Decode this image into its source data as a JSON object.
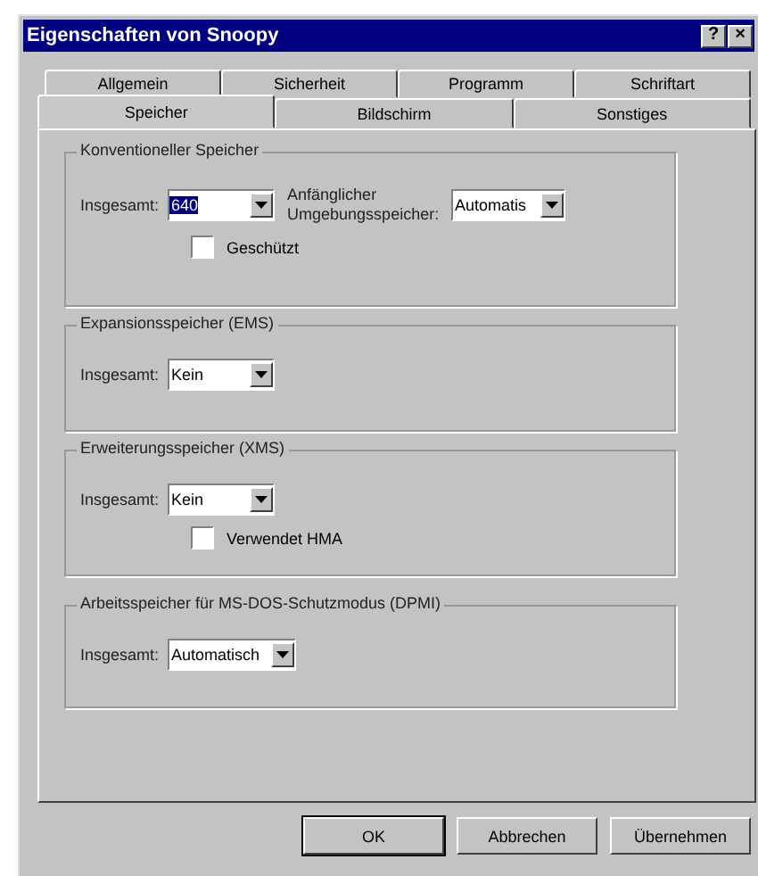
{
  "window": {
    "title": "Eigenschaften von Snoopy",
    "title_buttons": [
      "?",
      "×"
    ]
  },
  "tab_rows": [
    [
      {
        "label": "Allgemein",
        "selected": false
      },
      {
        "label": "Sicherheit",
        "selected": false
      },
      {
        "label": "Programm",
        "selected": false
      },
      {
        "label": "Schriftart",
        "selected": false
      }
    ],
    [
      {
        "label": "Speicher",
        "selected": true
      },
      {
        "label": "Bildschirm",
        "selected": false
      },
      {
        "label": "Sonstiges",
        "selected": false
      }
    ]
  ],
  "groups": [
    {
      "title": "Konventioneller Speicher",
      "total": {
        "label": "Insgesamt:",
        "value": "640",
        "highlighted": true
      },
      "env": {
        "label": "Anfänglicher Umgebungsspeicher:",
        "value": "Automatis"
      },
      "checkbox": {
        "label": "Geschützt",
        "checked": false
      }
    },
    {
      "title": "Expansionsspeicher (EMS)",
      "total": {
        "label": "Insgesamt:",
        "value": "Kein",
        "highlighted": false
      }
    },
    {
      "title": "Erweiterungsspeicher (XMS)",
      "total": {
        "label": "Insgesamt:",
        "value": "Kein",
        "highlighted": false
      },
      "checkbox": {
        "label": "Verwendet HMA",
        "checked": false
      }
    },
    {
      "title": "Arbeitsspeicher für MS-DOS-Schutzmodus (DPMI)",
      "total": {
        "label": "Insgesamt:",
        "value": "Automatisch",
        "highlighted": false
      }
    }
  ],
  "buttons": [
    "OK",
    "Abbrechen",
    "Übernehmen"
  ]
}
